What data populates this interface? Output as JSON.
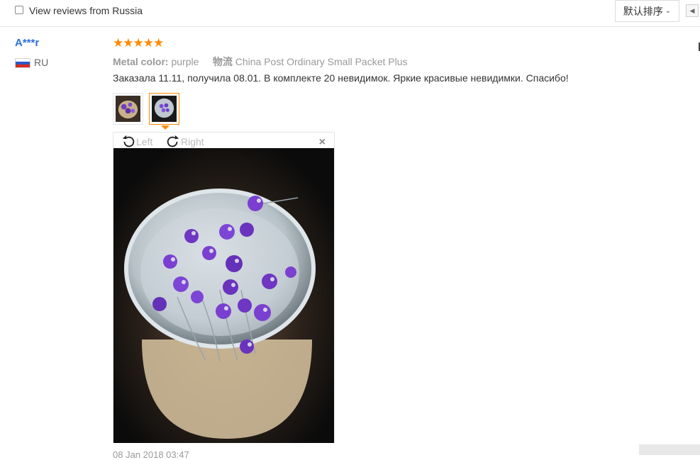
{
  "filter": {
    "label": "View reviews from Russia",
    "checked": false
  },
  "sort": {
    "label": "默认排序",
    "chevron": "chevron-down-icon"
  },
  "pager": {
    "icon": "triangle-left-icon"
  },
  "review": {
    "user": "A***r",
    "country": "RU",
    "rating": 5,
    "stars": "★★★★★",
    "attributes": [
      {
        "key": "Metal color:",
        "value": "purple"
      },
      {
        "key": "物流",
        "value": "China Post Ordinary Small Packet Plus"
      }
    ],
    "text": "Заказала 11.11, получила 08.01. В комплекте 20 невидимок. Яркие красивые невидимки. Спасибо!",
    "date": "08 Jan 2018 03:47"
  },
  "viewer": {
    "rotate_left_label": "Left",
    "rotate_right_label": "Right",
    "close_label": "×"
  },
  "colors": {
    "accent": "#ff8a00",
    "username": "#2a6fd8",
    "flower": "#7a3fd0"
  }
}
